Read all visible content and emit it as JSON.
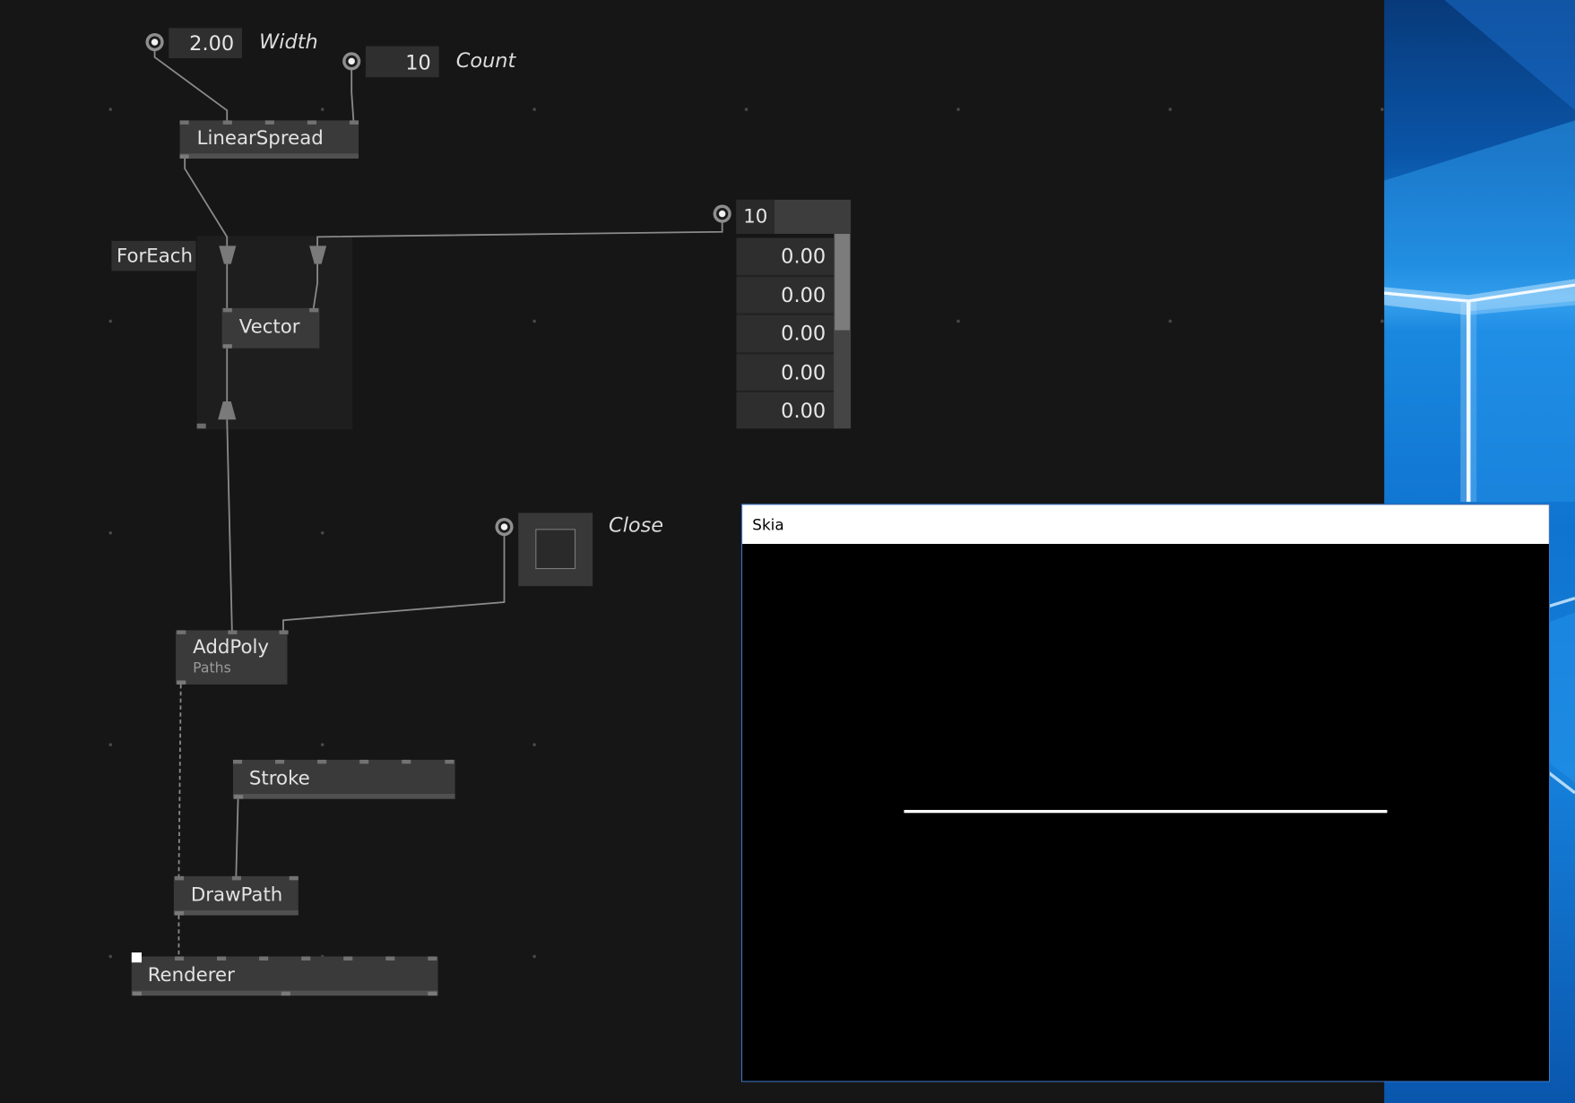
{
  "editor": {
    "iobox_width": {
      "value": "2.00",
      "label": "Width"
    },
    "iobox_count": {
      "value": "10",
      "label": "Count"
    },
    "node_linearspread": {
      "label": "LinearSpread"
    },
    "region_foreach": {
      "label": "ForEach"
    },
    "node_vector": {
      "label": "Vector"
    },
    "iobox_spread": {
      "count": "10",
      "values": [
        "0.00",
        "0.00",
        "0.00",
        "0.00",
        "0.00"
      ]
    },
    "toggle_close": {
      "label": "Close",
      "checked": false
    },
    "node_addpoly": {
      "label": "AddPoly",
      "category": "Paths"
    },
    "node_stroke": {
      "label": "Stroke"
    },
    "node_drawpath": {
      "label": "DrawPath"
    },
    "node_renderer": {
      "label": "Renderer"
    }
  },
  "skia_window": {
    "title": "Skia"
  },
  "icons": {
    "iobox_pin": "iobox-pin-icon",
    "splicer_in": "splicer-input-icon",
    "splicer_out": "splicer-output-icon"
  },
  "colors": {
    "canvas_bg": "#161616",
    "node_bg": "#3a3a3a",
    "link": "#8a8a8a",
    "skia_bg": "#000000",
    "skia_line": "#ffffff",
    "desktop_blue": "#0f74d0",
    "window_border": "#3d78c9"
  }
}
